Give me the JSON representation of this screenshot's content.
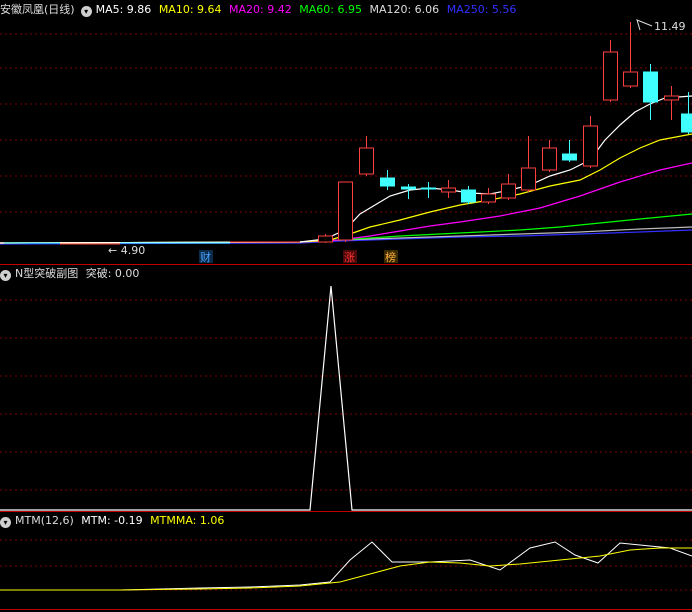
{
  "main_panel": {
    "title": "安徽凤凰(日线)",
    "indicators": [
      {
        "label": "MA5: 9.86",
        "color": "#ffffff"
      },
      {
        "label": "MA10: 9.64",
        "color": "#ffff00"
      },
      {
        "label": "MA20: 9.42",
        "color": "#ff00ff"
      },
      {
        "label": "MA60: 6.95",
        "color": "#00ff00"
      },
      {
        "label": "MA120: 6.06",
        "color": "#dddddd"
      },
      {
        "label": "MA250: 5.56",
        "color": "#3030ff"
      }
    ],
    "high_label": "11.49",
    "low_label": "4.90",
    "markers": [
      {
        "text": "财",
        "color": "#4aa3ff"
      },
      {
        "text": "涨",
        "color": "#ff3030"
      },
      {
        "text": "榜",
        "color": "#ffb040"
      }
    ]
  },
  "sub_panel_1": {
    "title": "N型突破副图",
    "indicator": "突破: 0.00"
  },
  "sub_panel_2": {
    "title": "MTM(12,6)",
    "mtm": "MTM: -0.19",
    "mtmma": "MTMMA: 1.06",
    "mtm_color": "#ffffff",
    "mtmma_color": "#ffff00"
  },
  "colors": {
    "up": "#ff4040",
    "down": "#40ffff",
    "grid": "#800000",
    "border": "#b00000"
  }
}
